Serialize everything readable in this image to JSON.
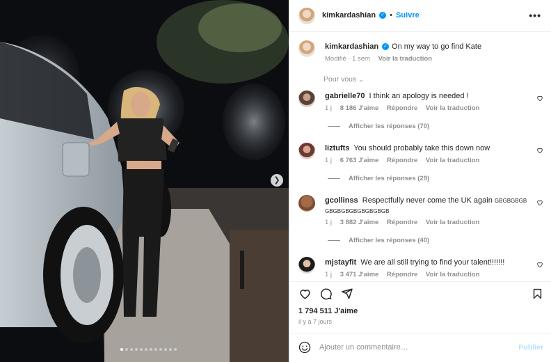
{
  "post": {
    "username": "kimkardashian",
    "follow_label": "Suivre",
    "caption": "On my way to go find Kate",
    "caption_meta": {
      "edited": "Modifié · 1 sem",
      "translate": "Voir la traduction"
    },
    "pour_vous": "Pour vous"
  },
  "comments": [
    {
      "username": "gabrielle70",
      "text": "I think an apology is needed !",
      "time": "1 j",
      "likes": "8 186 J'aime",
      "reply": "Répondre",
      "translate": "Voir la traduction",
      "replies": "Afficher les réponses (70)"
    },
    {
      "username": "liztufts",
      "text": "You should probably take this down now",
      "time": "1 j",
      "likes": "6 763 J'aime",
      "reply": "Répondre",
      "translate": "Voir la traduction",
      "replies": "Afficher les réponses (29)"
    },
    {
      "username": "gcollinss",
      "text": "Respectfully never come the UK again",
      "text_tail": "GBGBGBGBGBGBGBGBGBGBGBGB",
      "time": "1 j",
      "likes": "3 882 J'aime",
      "reply": "Répondre",
      "translate": "Voir la traduction",
      "replies": "Afficher les réponses (40)"
    },
    {
      "username": "mjstayfit",
      "text": "We are all still trying to find your talent!!!!!!!",
      "time": "1 j",
      "likes": "3 471 J'aime",
      "reply": "Répondre",
      "translate": "Voir la traduction"
    }
  ],
  "engagement": {
    "likes": "1 794 511 J'aime",
    "ago": "il y a 7 jours"
  },
  "add_comment": {
    "placeholder": "Ajouter un commentaire…",
    "publish": "Publier"
  },
  "carousel": {
    "total": 12,
    "active_index": 0
  },
  "colors": {
    "accent": "#0095f6",
    "muted": "#8e8e8e",
    "text": "#262626",
    "border": "#efefef"
  },
  "icons": [
    "more-icon",
    "verified-icon",
    "heart-icon",
    "comment-icon",
    "share-icon",
    "bookmark-icon",
    "emoji-icon",
    "chevron-down-icon",
    "next-arrow-icon"
  ]
}
